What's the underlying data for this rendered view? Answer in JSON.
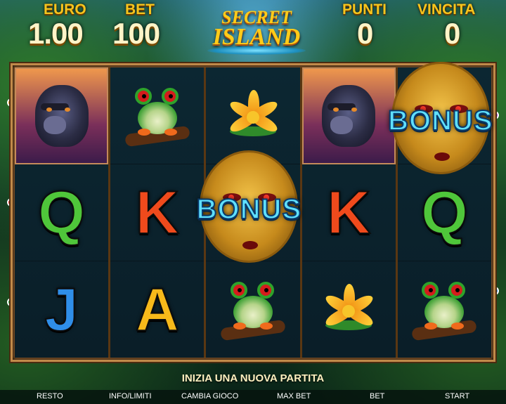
{
  "header": {
    "euro_label": "EURO",
    "euro_value": "1.00",
    "bet_label": "BET",
    "bet_value": "100",
    "punti_label": "PUNTI",
    "punti_value": "0",
    "vincita_label": "VINCITA",
    "vincita_value": "0"
  },
  "logo": {
    "line1": "SECRET",
    "line2": "ISLAND"
  },
  "reels": [
    [
      "gorilla",
      "Q",
      "J"
    ],
    [
      "frog",
      "K",
      "A"
    ],
    [
      "flower",
      "bonus",
      "frog"
    ],
    [
      "gorilla",
      "K",
      "flower"
    ],
    [
      "bonus",
      "Q",
      "frog"
    ]
  ],
  "bonus_label": "BONUS",
  "letters": {
    "Q": "Q",
    "K": "K",
    "J": "J",
    "A": "A"
  },
  "message": "INIZIA UNA NUOVA PARTITA",
  "buttons": {
    "resto": "RESTO",
    "info": "INFO/LIMITI",
    "cambia": "CAMBIA GIOCO",
    "maxbet": "MAX BET",
    "bet": "BET",
    "start": "START"
  },
  "colors": {
    "gold": "#f6c41d",
    "letter_green": "#4fc63a",
    "letter_red": "#f04a1c",
    "letter_blue": "#2f8ee8",
    "letter_gold": "#f7b91a",
    "bonus_text": "#5fe0ff"
  }
}
